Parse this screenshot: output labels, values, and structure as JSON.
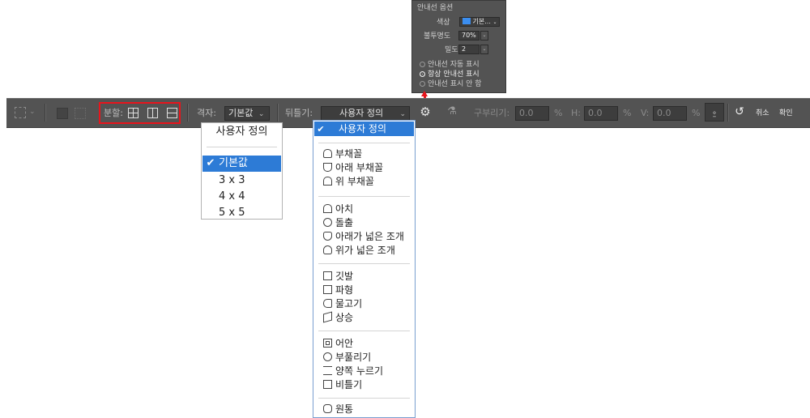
{
  "colors": {
    "toolbar_bg": "#535353",
    "highlight": "#e8141c",
    "selection": "#2d7bd6",
    "swatch": "#3b8ef0"
  },
  "toolbar": {
    "split_label": "분할:",
    "grid_label": "격자:",
    "grid_value": "기본값",
    "warp_label": "뒤틀기:",
    "warp_value": "사용자 정의",
    "bend_label": "구부리기:",
    "bend_value": "0.0",
    "h_label": "H:",
    "h_value": "0.0",
    "v_label": "V:",
    "v_value": "0.0",
    "percent": "%",
    "cancel_label": "취소",
    "confirm_label": "확인",
    "icons": [
      "transform-select-icon",
      "split-cross-icon",
      "split-vertical-icon",
      "split-horizontal-icon",
      "gear-icon",
      "warp-orientation-icon",
      "warp-mode-icon",
      "reset-icon"
    ]
  },
  "grid_menu": {
    "items": [
      {
        "label": "사용자 정의",
        "selected": false
      },
      {
        "label": "기본값",
        "selected": true
      },
      {
        "label": "3 x 3",
        "selected": false
      },
      {
        "label": "4 x 4",
        "selected": false
      },
      {
        "label": "5 x 5",
        "selected": false
      }
    ]
  },
  "warp_menu": {
    "selected": "사용자 정의",
    "groups": [
      [
        "부채꼴",
        "아래 부채꼴",
        "위 부채꼴"
      ],
      [
        "아치",
        "돌출",
        "아래가 넓은 조개",
        "위가 넓은 조개"
      ],
      [
        "깃발",
        "파형",
        "물고기",
        "상승"
      ],
      [
        "어안",
        "부풀리기",
        "양쪽 누르기",
        "비틀기"
      ],
      [
        "원통"
      ]
    ]
  },
  "guide_popup": {
    "title": "안내선 옵션",
    "color_label": "색상",
    "color_value": "기본...",
    "opacity_label": "불투명도",
    "opacity_value": "70%",
    "density_label": "밀도",
    "density_value": "2",
    "options": [
      {
        "label": "안내선 자동 표시",
        "selected": false
      },
      {
        "label": "항상 안내선 표시",
        "selected": true
      },
      {
        "label": "안내선 표시 안 함",
        "selected": false
      }
    ]
  }
}
